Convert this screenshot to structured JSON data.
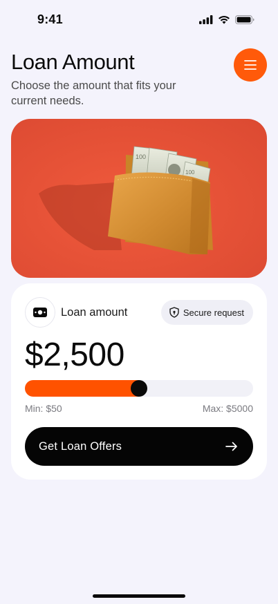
{
  "status_bar": {
    "time": "9:41",
    "icons": [
      "signal-icon",
      "wifi-icon",
      "battery-icon"
    ]
  },
  "header": {
    "title": "Loan Amount",
    "subtitle": "Choose the amount that fits your current needs.",
    "menu_icon": "menu-icon"
  },
  "hero": {
    "image": "wallet-with-cash-photo"
  },
  "loan_card": {
    "icon": "cash-icon",
    "label": "Loan amount",
    "badge": {
      "icon": "shield-icon",
      "label": "Secure request"
    },
    "amount": "$2,500",
    "slider": {
      "min": 50,
      "max": 5000,
      "value": 2500,
      "fill_fraction": 0.5
    },
    "min_label": "Min: $50",
    "max_label": "Max: $5000",
    "cta": {
      "label": "Get Loan Offers",
      "icon": "arrow-right-icon"
    }
  },
  "colors": {
    "accent": "#ff5a0a",
    "background": "#f4f3fc",
    "card": "#ffffff",
    "cta": "#050505",
    "track": "#f1f1f7"
  }
}
